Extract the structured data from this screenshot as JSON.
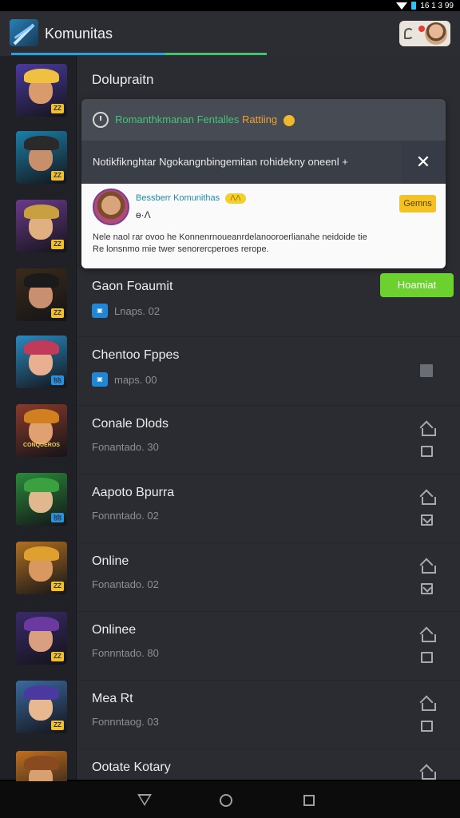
{
  "status_bar": {
    "time": "16 1 3 99"
  },
  "app_bar": {
    "title": "Komunitas"
  },
  "section": {
    "title": "Dolupraitn"
  },
  "popup": {
    "header_text": "Romanthkmanan Fentalles",
    "header_rating": "Rattiing",
    "subheader_text": "Notikfiknghtar Ngokangnbingemitan rohidekny oneenl +",
    "close_label": "✕",
    "user_name": "Bessberr Komunithas",
    "user_tag": "ɅɅ",
    "user_meta": "ɵ·Ʌ",
    "action_label": "Gemns",
    "description_line1": "Nele naol rar ovoo he Konnenrnoueanrdelanooroerlianahe neidoide tie",
    "description_line2": "Re lonsnmo mie twer senorercperoes rerope."
  },
  "rows": [
    {
      "title": "Gaon Foaumit",
      "subtitle": "Lnaps. 02",
      "icon_badge": "▣",
      "action": "Hoamiat"
    },
    {
      "title": "Chentoo Fppes",
      "subtitle": "maps. 00",
      "icon_badge": "▣"
    },
    {
      "title": "Conale Dlods",
      "subtitle": "Fonantado. 30"
    },
    {
      "title": "Aapoto Bpurra",
      "subtitle": "Fonnntado. 02"
    },
    {
      "title": "Online",
      "subtitle": "Fonantado. 02"
    },
    {
      "title": "Onlinee",
      "subtitle": "Fonnntado. 80"
    },
    {
      "title": "Mea Rt",
      "subtitle": "Fonnntaog. 03"
    },
    {
      "title": "Ootate Kotary",
      "subtitle": ""
    }
  ],
  "sidebar": {
    "thumbs": [
      {
        "name": "hero-1",
        "bg": "#4a3aa0",
        "hat": "#f0c040",
        "face": "#d99a6c",
        "badge": "ZZ",
        "badge_color": "#f0c030"
      },
      {
        "name": "hero-2",
        "bg": "#1a7fa8",
        "hat": "#2a2a2a",
        "face": "#c8906a",
        "badge": "ZZ",
        "badge_color": "#f0c030"
      },
      {
        "name": "hero-3",
        "bg": "#6a3a8a",
        "hat": "#c8a040",
        "face": "#e0b080",
        "badge": "ZZ",
        "badge_color": "#f0c030"
      },
      {
        "name": "hero-4",
        "bg": "#3a2a1a",
        "hat": "#1a1a1a",
        "face": "#c89070",
        "badge": "ZZ",
        "badge_color": "#f0c030"
      },
      {
        "name": "hero-5",
        "bg": "#2a8ac0",
        "hat": "#c03a5a",
        "face": "#e8b090",
        "badge": "ɮɮ",
        "badge_color": "#2a90e0"
      },
      {
        "name": "hero-6",
        "bg": "#8a3a2a",
        "hat": "#d08020",
        "face": "#e0a070",
        "badge": "CONQUEROS",
        "badge_color": "#f0c030"
      },
      {
        "name": "hero-7",
        "bg": "#2a8a3a",
        "hat": "#3aa040",
        "face": "#e0b890",
        "badge": "ɮɮ",
        "badge_color": "#2a90e0"
      },
      {
        "name": "hero-8",
        "bg": "#b07020",
        "hat": "#e0a030",
        "face": "#d89860",
        "badge": "ZZ",
        "badge_color": "#f0c030"
      },
      {
        "name": "hero-9",
        "bg": "#3a2a6a",
        "hat": "#6a3aa0",
        "face": "#d8a080",
        "badge": "ZZ",
        "badge_color": "#f0c030"
      },
      {
        "name": "hero-10",
        "bg": "#3a6aa0",
        "hat": "#4a3aa0",
        "face": "#e8b890",
        "badge": "ZZ",
        "badge_color": "#f0c030"
      },
      {
        "name": "hero-11",
        "bg": "#c07020",
        "hat": "#8a4a20",
        "face": "#d8a070",
        "badge": "",
        "badge_color": "#f0c030"
      }
    ]
  },
  "colors": {
    "accent_blue": "#1fa6e0",
    "accent_green": "#3fc46a",
    "action_green": "#6cd12f",
    "rating_orange": "#f0a030",
    "tag_yellow": "#f5d028"
  }
}
